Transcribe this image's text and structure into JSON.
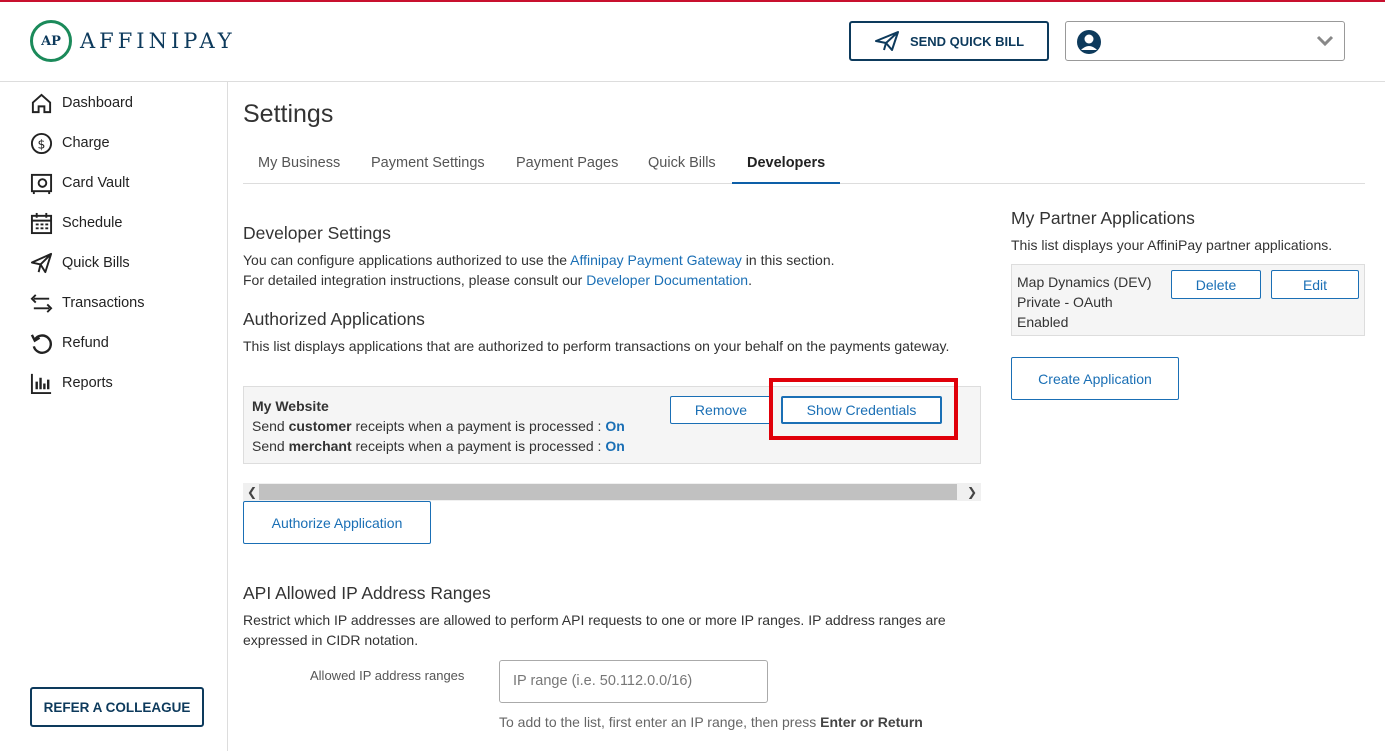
{
  "header": {
    "logo_initials": "AP",
    "logo_text": "AFFINIPAY",
    "send_quick_bill_label": "SEND QUICK BILL"
  },
  "sidebar": {
    "items": [
      {
        "label": "Dashboard",
        "icon": "home-icon"
      },
      {
        "label": "Charge",
        "icon": "dollar-icon"
      },
      {
        "label": "Card Vault",
        "icon": "vault-icon"
      },
      {
        "label": "Schedule",
        "icon": "calendar-icon"
      },
      {
        "label": "Quick Bills",
        "icon": "paper-plane-icon"
      },
      {
        "label": "Transactions",
        "icon": "arrows-icon"
      },
      {
        "label": "Refund",
        "icon": "refund-icon"
      },
      {
        "label": "Reports",
        "icon": "bar-chart-icon"
      }
    ],
    "refer_label": "REFER A COLLEAGUE"
  },
  "page": {
    "title": "Settings",
    "tabs": [
      {
        "label": "My Business",
        "active": false
      },
      {
        "label": "Payment Settings",
        "active": false
      },
      {
        "label": "Payment Pages",
        "active": false
      },
      {
        "label": "Quick Bills",
        "active": false
      },
      {
        "label": "Developers",
        "active": true
      }
    ]
  },
  "developer": {
    "heading": "Developer Settings",
    "line1_prefix": "You can configure applications authorized to use the ",
    "line1_link": "Affinipay Payment Gateway",
    "line1_suffix": " in this section.",
    "line2_prefix": "For detailed integration instructions, please consult our ",
    "line2_link": "Developer Documentation",
    "line2_suffix": "."
  },
  "authorized": {
    "heading": "Authorized Applications",
    "description": "This list displays applications that are authorized to perform transactions on your behalf on the payments gateway.",
    "app": {
      "name": "My Website",
      "customer_prefix": "Send ",
      "customer_bold": "customer",
      "customer_suffix": " receipts when a payment is processed : ",
      "customer_value": "On",
      "merchant_prefix": "Send ",
      "merchant_bold": "merchant",
      "merchant_suffix": " receipts when a payment is processed : ",
      "merchant_value": "On",
      "remove_label": "Remove",
      "show_credentials_label": "Show Credentials"
    },
    "authorize_label": "Authorize Application"
  },
  "api_ip": {
    "heading": "API Allowed IP Address Ranges",
    "description": "Restrict which IP addresses are allowed to perform API requests to one or more IP ranges. IP address ranges are expressed in CIDR notation.",
    "field_label": "Allowed IP address ranges",
    "placeholder": "IP range (i.e. 50.112.0.0/16)",
    "hint_prefix": "To add to the list, first enter an IP range, then press ",
    "hint_bold": "Enter or Return"
  },
  "partner": {
    "heading": "My Partner Applications",
    "description": "This list displays your AffiniPay partner applications.",
    "app_name": "Map Dynamics (DEV)",
    "app_type": "Private - OAuth",
    "app_status": "Enabled",
    "delete_label": "Delete",
    "edit_label": "Edit",
    "create_label": "Create Application"
  },
  "colors": {
    "brand": "#0d3a5c",
    "link": "#1a6fb5",
    "highlight": "#e0000a"
  }
}
